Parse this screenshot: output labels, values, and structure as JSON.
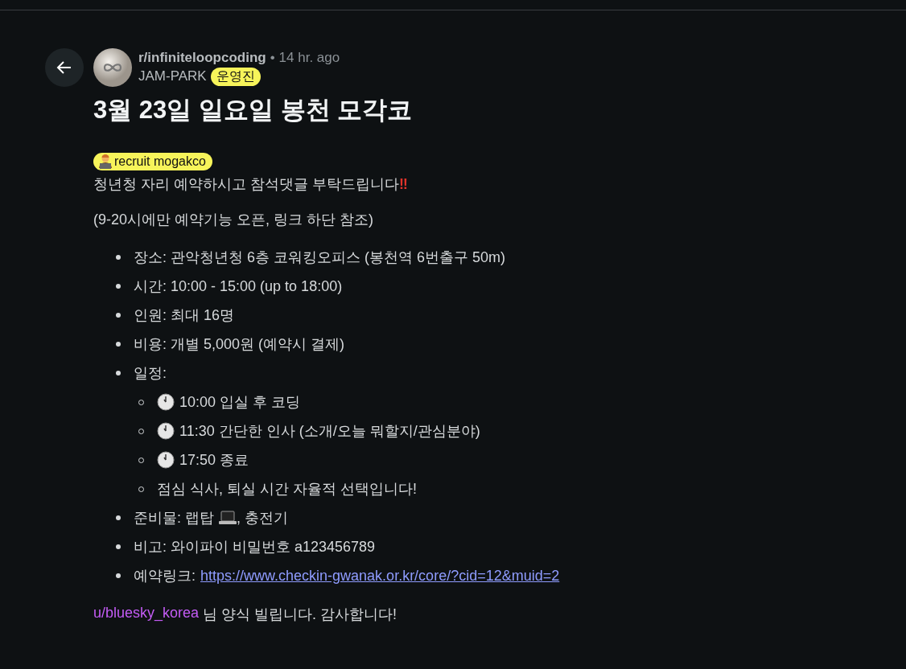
{
  "post": {
    "subreddit": "r/infiniteloopcoding",
    "separator": "•",
    "time": "14 hr. ago",
    "author": "JAM-PARK",
    "author_badge": "운영진",
    "title": "3월 23일 일요일 봉천 모각코",
    "flair": "recruit mogakco"
  },
  "body": {
    "intro": "청년청 자리 예약하시고 참석댓글 부탁드립니다",
    "intro_mark": "‼",
    "note": "(9-20시에만 예약기능 오픈, 링크 하단 참조)",
    "items": [
      {
        "kind": "text",
        "text": "장소: 관악청년청 6층 코워킹오피스 (봉천역 6번출구 50m)"
      },
      {
        "kind": "text",
        "text": "시간: 10:00 - 15:00 (up to 18:00)"
      },
      {
        "kind": "text",
        "text": "인원: 최대 16명"
      },
      {
        "kind": "text",
        "text": "비용: 개별 5,000원 (예약시 결제)"
      },
      {
        "kind": "text",
        "text": "일정:",
        "children": [
          {
            "kind": "clock",
            "text": "10:00 입실 후 코딩"
          },
          {
            "kind": "clock",
            "text": "11:30 간단한 인사 (소개/오늘 뭐할지/관심분야)"
          },
          {
            "kind": "clock",
            "text": "17:50 종료"
          },
          {
            "kind": "text",
            "text": "점심 식사, 퇴실 시간 자율적 선택입니다!"
          }
        ]
      },
      {
        "kind": "laptop",
        "text": "준비물: 랩탑",
        "after": ", 충전기"
      },
      {
        "kind": "text",
        "text": "비고: 와이파이 비밀번호 a123456789"
      },
      {
        "kind": "link",
        "text": "예약링크:",
        "link": "https://www.checkin-gwanak.or.kr/core/?cid=12&muid=2"
      }
    ],
    "footer_user": "u/bluesky_korea",
    "footer_text": "님 양식 빌립니다. 감사합니다!"
  }
}
